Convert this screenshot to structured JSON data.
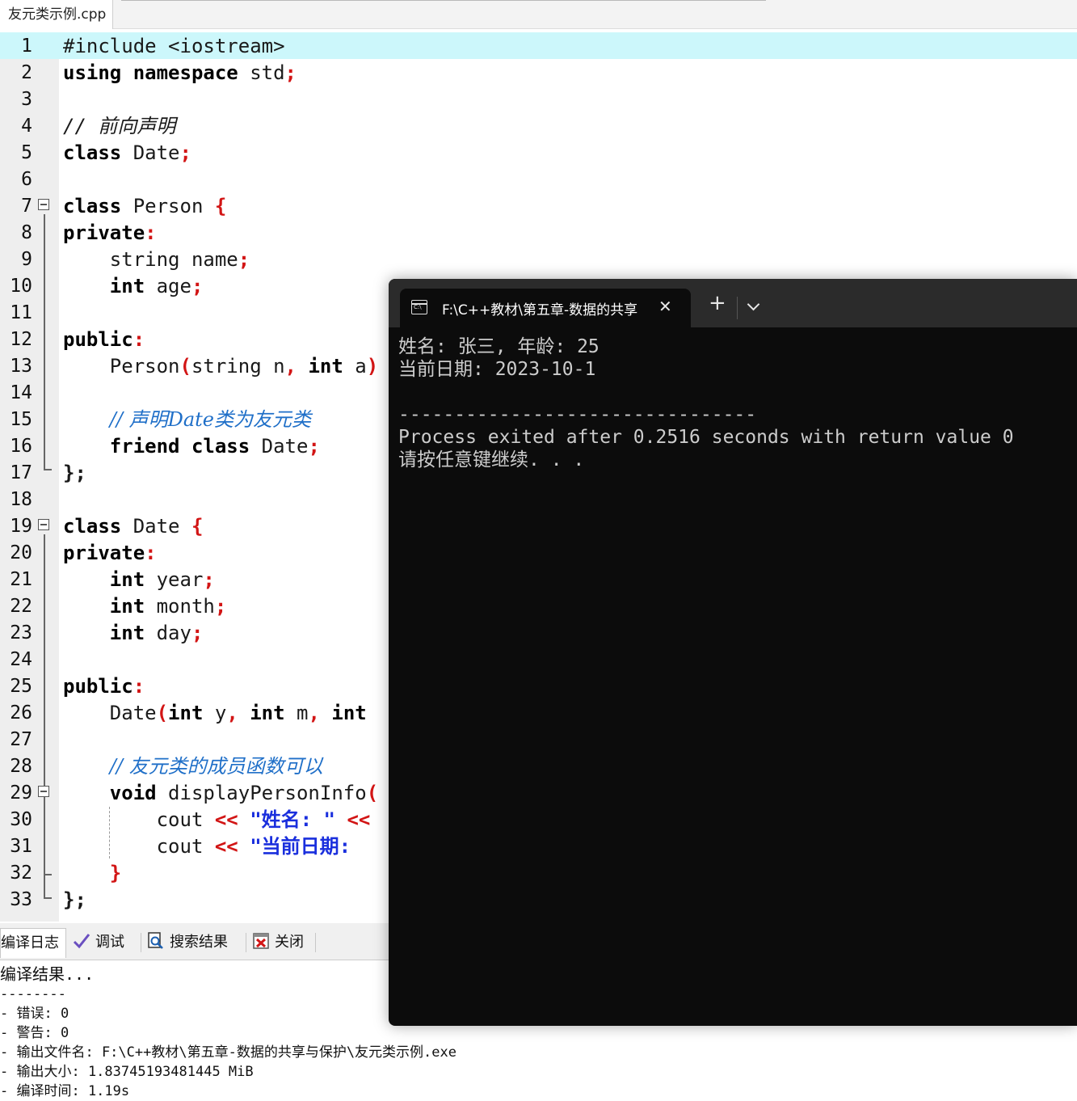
{
  "editor": {
    "tab_label": "友元类示例.cpp"
  },
  "lines": {
    "n1": "1",
    "n2": "2",
    "n3": "3",
    "n4": "4",
    "n5": "5",
    "n6": "6",
    "n7": "7",
    "n8": "8",
    "n9": "9",
    "n10": "10",
    "n11": "11",
    "n12": "12",
    "n13": "13",
    "n14": "14",
    "n15": "15",
    "n16": "16",
    "n17": "17",
    "n18": "18",
    "n19": "19",
    "n20": "20",
    "n21": "21",
    "n22": "22",
    "n23": "23",
    "n24": "24",
    "n25": "25",
    "n26": "26",
    "n27": "27",
    "n28": "28",
    "n29": "29",
    "n30": "30",
    "n31": "31",
    "n32": "32",
    "n33": "33"
  },
  "code": {
    "l1": "#include <iostream>",
    "l2_kw": "using namespace",
    "l2_rest": " std",
    "l2_p": ";",
    "l4": "// 前向声明",
    "l5_kw": "class",
    "l5_rest": " Date",
    "l5_p": ";",
    "l7_kw": "class",
    "l7_rest": " Person ",
    "l7_p": "{",
    "l8_kw": "private",
    "l8_p": ":",
    "l9_rest": "    string name",
    "l9_p": ";",
    "l10_kw": "int",
    "l10_rest": " age",
    "l10_p": ";",
    "l12_kw": "public",
    "l12_p": ":",
    "l13_a": "    Person",
    "l13_p1": "(",
    "l13_b": "string n",
    "l13_p2": ",",
    "l13_kw": "int",
    "l13_c": " a",
    "l13_p3": ")",
    "l15": "// 声明Date类为友元类",
    "l16_kw": "friend class",
    "l16_rest": " Date",
    "l16_p": ";",
    "l17_p": "};",
    "l19_kw": "class",
    "l19_rest": " Date ",
    "l19_p": "{",
    "l20_kw": "private",
    "l20_p": ":",
    "l21_kw": "int",
    "l21_rest": " year",
    "l21_p": ";",
    "l22_kw": "int",
    "l22_rest": " month",
    "l22_p": ";",
    "l23_kw": "int",
    "l23_rest": " day",
    "l23_p": ";",
    "l25_kw": "public",
    "l25_p": ":",
    "l26_a": "    Date",
    "l26_p1": "(",
    "l26_kw1": "int",
    "l26_b": " y",
    "l26_p2": ",",
    "l26_kw2": "int",
    "l26_c": " m",
    "l26_p3": ",",
    "l26_kw3": "int",
    "l28": "// 友元类的成员函数可以",
    "l29_kw": "void",
    "l29_rest": " displayPersonInfo",
    "l29_p": "(",
    "l30_a": "cout ",
    "l30_op": "<<",
    "l30_str": " \"姓名: \" ",
    "l30_op2": "<<",
    "l31_a": "cout ",
    "l31_op": "<<",
    "l31_str": " \"当前日期:",
    "l32_p": "}",
    "l33_p": "};"
  },
  "bottom": {
    "tab_compile_log": "编译日志",
    "tab_debug": "调试",
    "tab_search": "搜索结果",
    "tab_close": "关闭",
    "log": [
      "编译结果...",
      "--------",
      "- 错误: 0",
      "- 警告: 0",
      "- 输出文件名: F:\\C++教材\\第五章-数据的共享与保护\\友元类示例.exe",
      "- 输出大小: 1.83745193481445 MiB",
      "- 编译时间: 1.19s"
    ]
  },
  "terminal": {
    "tab_title": "F:\\C++教材\\第五章-数据的共享",
    "output": [
      "姓名: 张三, 年龄: 25",
      "当前日期: 2023-10-1",
      "",
      "--------------------------------",
      "Process exited after 0.2516 seconds with return value 0",
      "请按任意键继续. . ."
    ]
  },
  "colors": {
    "highlight_line": "#ccf7fb",
    "keyword": "#000000",
    "preprocessor": "#0a8a2a",
    "punctuation": "#d21515",
    "comment": "#1f6fc8",
    "string": "#1a2fdd",
    "terminal_bg": "#0c0c0c",
    "terminal_text": "#cccccc"
  },
  "icons": {
    "debug": "checkmark-icon",
    "search": "search-document-icon",
    "close": "close-window-icon",
    "terminal_app": "command-prompt-icon",
    "terminal_close": "close-icon",
    "terminal_new_tab": "plus-icon",
    "terminal_dropdown": "chevron-down-icon",
    "fold": "fold-collapse-icon"
  }
}
